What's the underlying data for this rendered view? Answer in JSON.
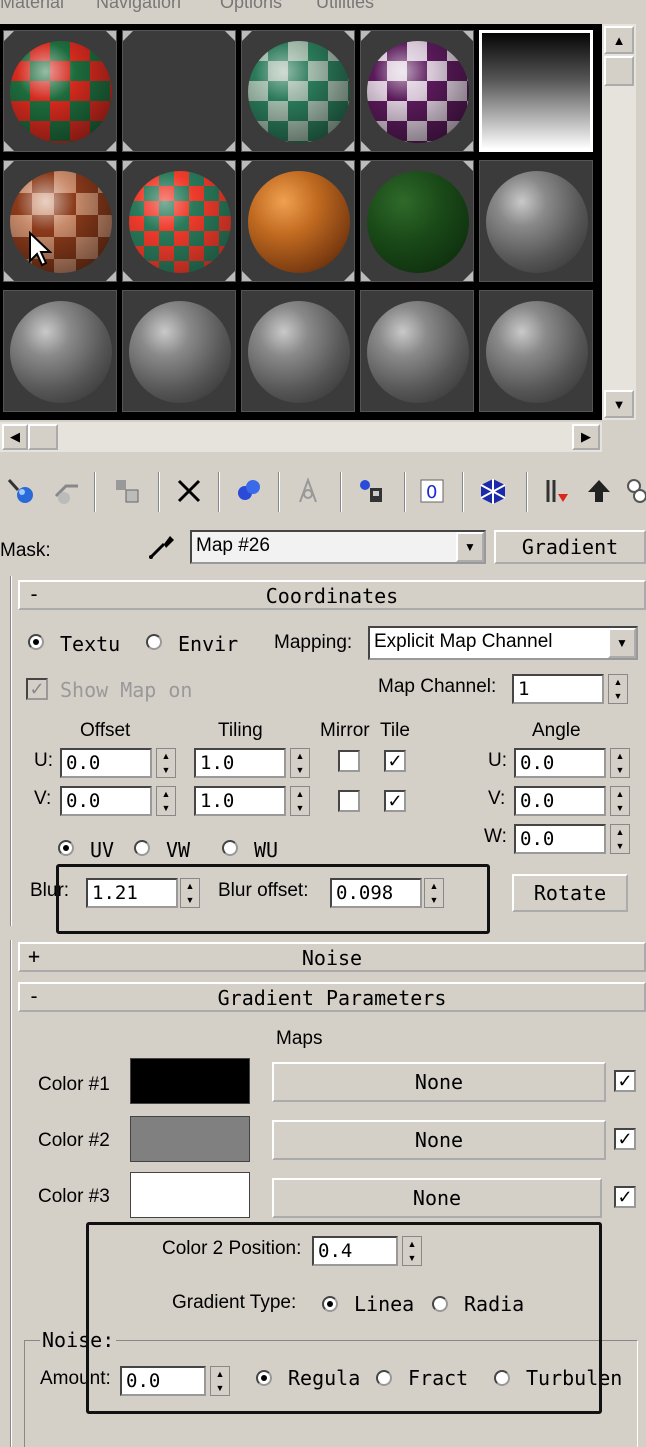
{
  "menu": [
    "Material",
    "Navigation",
    "Options",
    "Utilities"
  ],
  "toolbar": {
    "icons": [
      "get-material-icon",
      "put-to-scene-icon",
      "assign-to-selection-icon",
      "delete-icon",
      "make-unique-icon",
      "material-library-icon",
      "material-effects-channel-icon",
      "show-map-in-viewport-icon",
      "show-end-result-icon",
      "go-to-parent-icon",
      "go-forward-to-sibling-icon",
      "options-icon"
    ]
  },
  "mask": {
    "label": "Mask:",
    "name_value": "Map #26",
    "type_button": "Gradient"
  },
  "coordinates": {
    "sign": "-",
    "title": "Coordinates",
    "radio_texture": "Textu",
    "radio_environ": "Envir",
    "mapping_label": "Mapping:",
    "mapping_value": "Explicit Map Channel",
    "show_map_on": "Show Map on",
    "map_channel_label": "Map Channel:",
    "map_channel_value": "1",
    "offset_label": "Offset",
    "tiling_label": "Tiling",
    "mirror_label": "Mirror",
    "tile_label": "Tile",
    "angle_label": "Angle",
    "u_label": "U:",
    "v_label": "V:",
    "w_label": "W:",
    "offset_u": "0.0",
    "offset_v": "0.0",
    "tiling_u": "1.0",
    "tiling_v": "1.0",
    "angle_u": "0.0",
    "angle_v": "0.0",
    "angle_w": "0.0",
    "uv": "UV",
    "vw": "VW",
    "wu": "WU",
    "blur_label": "Blur:",
    "blur_value": "1.21",
    "blur_offset_label": "Blur offset:",
    "blur_offset_value": "0.098",
    "rotate_button": "Rotate"
  },
  "noise_rollout": {
    "sign": "+",
    "title": "Noise"
  },
  "gradient": {
    "sign": "-",
    "title": "Gradient Parameters",
    "maps_label": "Maps",
    "colors": [
      {
        "label": "Color #1",
        "swatch": "#000000",
        "map": "None"
      },
      {
        "label": "Color #2",
        "swatch": "#808080",
        "map": "None"
      },
      {
        "label": "Color #3",
        "swatch": "#ffffff",
        "map": "None"
      }
    ],
    "color2_position_label": "Color 2 Position:",
    "color2_position_value": "0.4",
    "gradient_type_label": "Gradient Type:",
    "type_linear": "Linea",
    "type_radial": "Radia",
    "noise_group": "Noise:",
    "amount_label": "Amount:",
    "amount_value": "0.0",
    "noise_regular": "Regula",
    "noise_fractal": "Fract",
    "noise_turbulence": "Turbulen"
  }
}
